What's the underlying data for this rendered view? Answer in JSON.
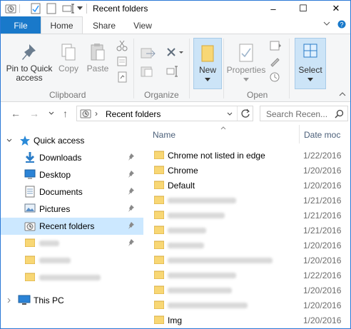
{
  "window": {
    "title": "Recent folders",
    "controls": {
      "minimize": "–",
      "maximize": "☐",
      "close": "✕"
    }
  },
  "ribbon_tabs": {
    "file": "File",
    "home": "Home",
    "share": "Share",
    "view": "View"
  },
  "ribbon": {
    "clipboard": {
      "pin_label_line1": "Pin to Quick",
      "pin_label_line2": "access",
      "copy": "Copy",
      "paste": "Paste",
      "group": "Clipboard"
    },
    "organize": {
      "group": "Organize"
    },
    "new": {
      "label": "New"
    },
    "open": {
      "properties": "Properties",
      "group": "Open"
    },
    "select": {
      "label": "Select"
    }
  },
  "address": {
    "path": "Recent folders",
    "separator": "›",
    "search_placeholder": "Search Recen..."
  },
  "nav": {
    "quick_access": "Quick access",
    "items": [
      {
        "label": "Downloads",
        "icon": "downloads-icon"
      },
      {
        "label": "Desktop",
        "icon": "desktop-icon"
      },
      {
        "label": "Documents",
        "icon": "documents-icon"
      },
      {
        "label": "Pictures",
        "icon": "pictures-icon"
      },
      {
        "label": "Recent folders",
        "icon": "recent-folders-icon"
      }
    ],
    "this_pc": "This PC"
  },
  "list": {
    "col_name": "Name",
    "col_date": "Date moc",
    "rows": [
      {
        "name": "Chrome not listed in edge",
        "date": "1/22/2016"
      },
      {
        "name": "Chrome",
        "date": "1/20/2016"
      },
      {
        "name": "Default",
        "date": "1/20/2016"
      },
      {
        "name": "",
        "date": "1/21/2016"
      },
      {
        "name": "",
        "date": "1/21/2016"
      },
      {
        "name": "",
        "date": "1/21/2016"
      },
      {
        "name": "",
        "date": "1/20/2016"
      },
      {
        "name": "",
        "date": "1/20/2016"
      },
      {
        "name": "",
        "date": "1/22/2016"
      },
      {
        "name": "",
        "date": "1/20/2016"
      },
      {
        "name": "",
        "date": "1/20/2016"
      },
      {
        "name": "Img",
        "date": "1/20/2016"
      }
    ]
  },
  "colors": {
    "accent": "#1979ca",
    "selection": "#cce8ff",
    "folder": "#f8d775"
  }
}
